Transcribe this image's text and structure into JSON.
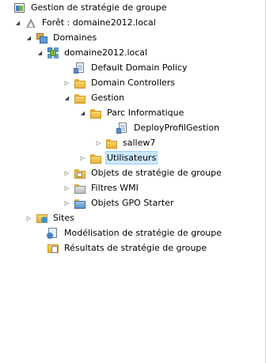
{
  "tree": {
    "items": [
      {
        "label": "Gestion de stratégie de groupe",
        "icon": "group-policy-management-icon",
        "expander": "none"
      },
      {
        "label": "Forêt : domaine2012.local",
        "icon": "forest-icon",
        "expander": "expanded"
      },
      {
        "label": "Domaines",
        "icon": "domains-icon",
        "expander": "expanded"
      },
      {
        "label": "domaine2012.local",
        "icon": "domain-icon",
        "expander": "expanded"
      },
      {
        "label": "Default Domain Policy",
        "icon": "gpo-link-icon",
        "expander": "none"
      },
      {
        "label": "Domain Controllers",
        "icon": "ou-folder-icon",
        "expander": "collapsed"
      },
      {
        "label": "Gestion",
        "icon": "ou-folder-icon",
        "expander": "expanded"
      },
      {
        "label": "Parc Informatique",
        "icon": "ou-folder-icon",
        "expander": "expanded"
      },
      {
        "label": "DeployProfilGestion",
        "icon": "gpo-link-icon",
        "expander": "none"
      },
      {
        "label": "sallew7",
        "icon": "ou-folder-icon",
        "expander": "collapsed"
      },
      {
        "label": "Utilisateurs",
        "icon": "ou-folder-icon",
        "expander": "collapsed",
        "selected": true
      },
      {
        "label": "Objets de stratégie de groupe",
        "icon": "gpo-folder-icon",
        "expander": "collapsed"
      },
      {
        "label": "Filtres WMI",
        "icon": "wmi-folder-icon",
        "expander": "collapsed"
      },
      {
        "label": "Objets GPO Starter",
        "icon": "starter-gpo-folder-icon",
        "expander": "collapsed"
      },
      {
        "label": "Sites",
        "icon": "sites-icon",
        "expander": "collapsed"
      },
      {
        "label": "Modélisation de stratégie de groupe",
        "icon": "modeling-icon",
        "expander": "none"
      },
      {
        "label": "Résultats de stratégie de groupe",
        "icon": "results-icon",
        "expander": "none"
      }
    ]
  },
  "colors": {
    "selection_bg": "#cce8ff",
    "selection_border": "#99d1ff"
  }
}
